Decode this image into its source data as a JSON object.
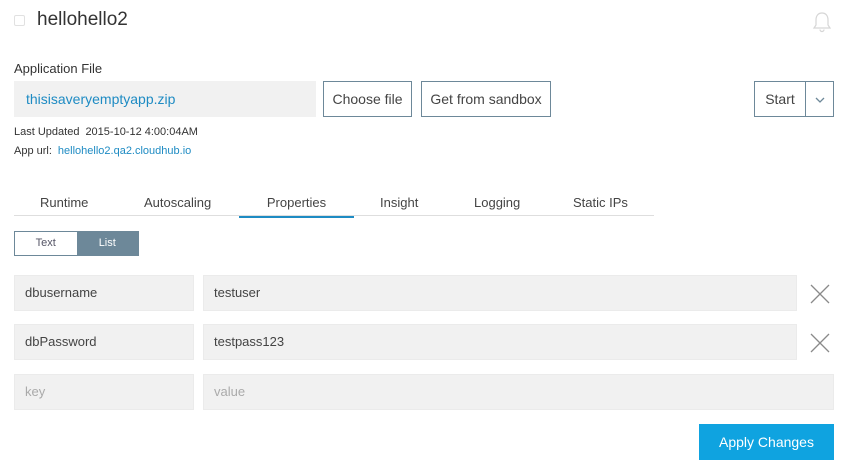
{
  "header": {
    "app_name": "hellohello2",
    "status_icon": "status-indicator-icon",
    "notification_icon": "bell-icon"
  },
  "application_file": {
    "label": "Application File",
    "file_name": "thisisaveryemptyapp.zip",
    "choose_label": "Choose file",
    "sandbox_label": "Get from sandbox",
    "start_label": "Start",
    "start_menu_icon": "chevron-down-icon"
  },
  "meta": {
    "last_updated_label": "Last Updated",
    "last_updated_value": "2015-10-12 4:00:04AM",
    "app_url_label": "App url:",
    "app_url_value": "hellohello2.qa2.cloudhub.io"
  },
  "tabs": [
    {
      "label": "Runtime"
    },
    {
      "label": "Autoscaling"
    },
    {
      "label": "Properties",
      "active": true
    },
    {
      "label": "Insight"
    },
    {
      "label": "Logging"
    },
    {
      "label": "Static IPs"
    }
  ],
  "view_toggle": {
    "text_label": "Text",
    "list_label": "List",
    "selected": "List"
  },
  "properties": [
    {
      "key": "dbusername",
      "value": "testuser"
    },
    {
      "key": "dbPassword",
      "value": "testpass123"
    }
  ],
  "new_property": {
    "key_placeholder": "key",
    "value_placeholder": "value"
  },
  "apply_label": "Apply Changes",
  "colors": {
    "accent": "#1e8bc3",
    "apply_bg": "#0fa3e0",
    "toggle_active": "#6d8899",
    "field_bg": "#f1f1f1"
  }
}
